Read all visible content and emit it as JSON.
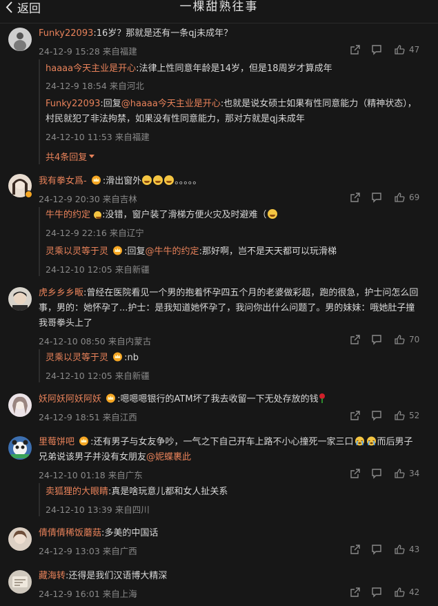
{
  "header": {
    "back_label": "返回",
    "title": "一棵甜熟往事"
  },
  "comments": [
    {
      "user": "Funky22093",
      "text": ":16岁？那就是还有一条qj未成年？",
      "time": "24-12-9 15:28",
      "location": "来自福建",
      "likes": "47",
      "replies": [
        {
          "user": "haaaa今天主业是开心",
          "text": ":法律上性同意年龄是14岁，但是18周岁才算成年",
          "time": "24-12-9 18:54",
          "location": "来自河北"
        },
        {
          "user": "Funky22093",
          "reply_prefix": ":回复",
          "mention": "@haaaa今天主业是开心",
          "text": ":也就是说女硕士如果有性同意能力（精神状态），",
          "text2": "村民就犯了非法拘禁，如果没有性同意能力，那对方就是qj未成年",
          "time": "24-12-10 11:53",
          "location": "来自福建"
        }
      ],
      "more_label": "共4条回复"
    },
    {
      "user": "我有拳女爲-",
      "text": ":滑出窗外",
      "text_tail": "。。。。。",
      "time": "24-12-9 20:30",
      "location": "来自吉林",
      "likes": "69",
      "replies": [
        {
          "user": "牛牛的约定",
          "text": ":没错，窗户装了滑梯方便火灾及时避难（",
          "time": "24-12-9 22:16",
          "location": "来自辽宁"
        },
        {
          "user": "灵乘以灵等于灵",
          "reply_prefix": ":回复",
          "mention": "@牛牛的约定",
          "text": ":那好啊，岂不是天天都可以玩滑梯",
          "time": "24-12-10 12:05",
          "location": "来自新疆"
        }
      ]
    },
    {
      "user": "虎乡乡乡畈",
      "text": ":曾经在医院看见一个男的抱着怀孕四五个月的老婆做彩超，跑的很急，护士问怎么回",
      "text2": "事，男的：她怀孕了...护士：是我知道她怀孕了，我问你出什么问题了。男的妹妹：哦她肚子撞",
      "text3": "我哥拳头上了",
      "time": "24-12-10 08:50",
      "location": "来自内蒙古",
      "likes": "70",
      "replies": [
        {
          "user": "灵乘以灵等于灵",
          "text": ":nb",
          "time": "24-12-10 12:05",
          "location": "来自新疆"
        }
      ]
    },
    {
      "user": "妖阿妖阿妖阿妖",
      "text": ":嗯嗯嗯银行的ATM坏了我去收留一下无处存放的钱",
      "time": "24-12-9 18:51",
      "location": "来自江西",
      "likes": "52"
    },
    {
      "user": "里莓饼吧",
      "text": ":还有男子与女友争吵，一气之下自己开车上路不小心撞死一家三口",
      "text_tail": "而后男子",
      "text2": "兄弟说该男子并没有女朋友",
      "mention": "@妮蝶裹此",
      "time": "24-12-10 01:18",
      "location": "来自广东",
      "likes": "34",
      "replies": [
        {
          "user": "卖狐狸的大眼睛",
          "text": ":真是啥玩意儿都和女人扯关系",
          "time": "24-12-10 13:39",
          "location": "来自四川"
        }
      ]
    },
    {
      "user": "倩倩倩稀饭蘑菇",
      "text": ":多美的中国话",
      "time": "24-12-9 13:03",
      "location": "来自广西",
      "likes": "43"
    },
    {
      "user": "藏海转",
      "text": ":还得是我们汉语博大精深",
      "time": "24-12-9 16:01",
      "location": "来自上海",
      "likes": "42"
    }
  ],
  "colors": {
    "background": "#171717",
    "username": "#e8825a",
    "meta": "#8a8a8a",
    "text": "#d8d8d8"
  },
  "icons": [
    "back-chevron-icon",
    "share-icon",
    "comment-icon",
    "like-icon",
    "crown-badge-icon",
    "grin-emoji-icon",
    "rose-icon",
    "crying-emoji-icon"
  ]
}
